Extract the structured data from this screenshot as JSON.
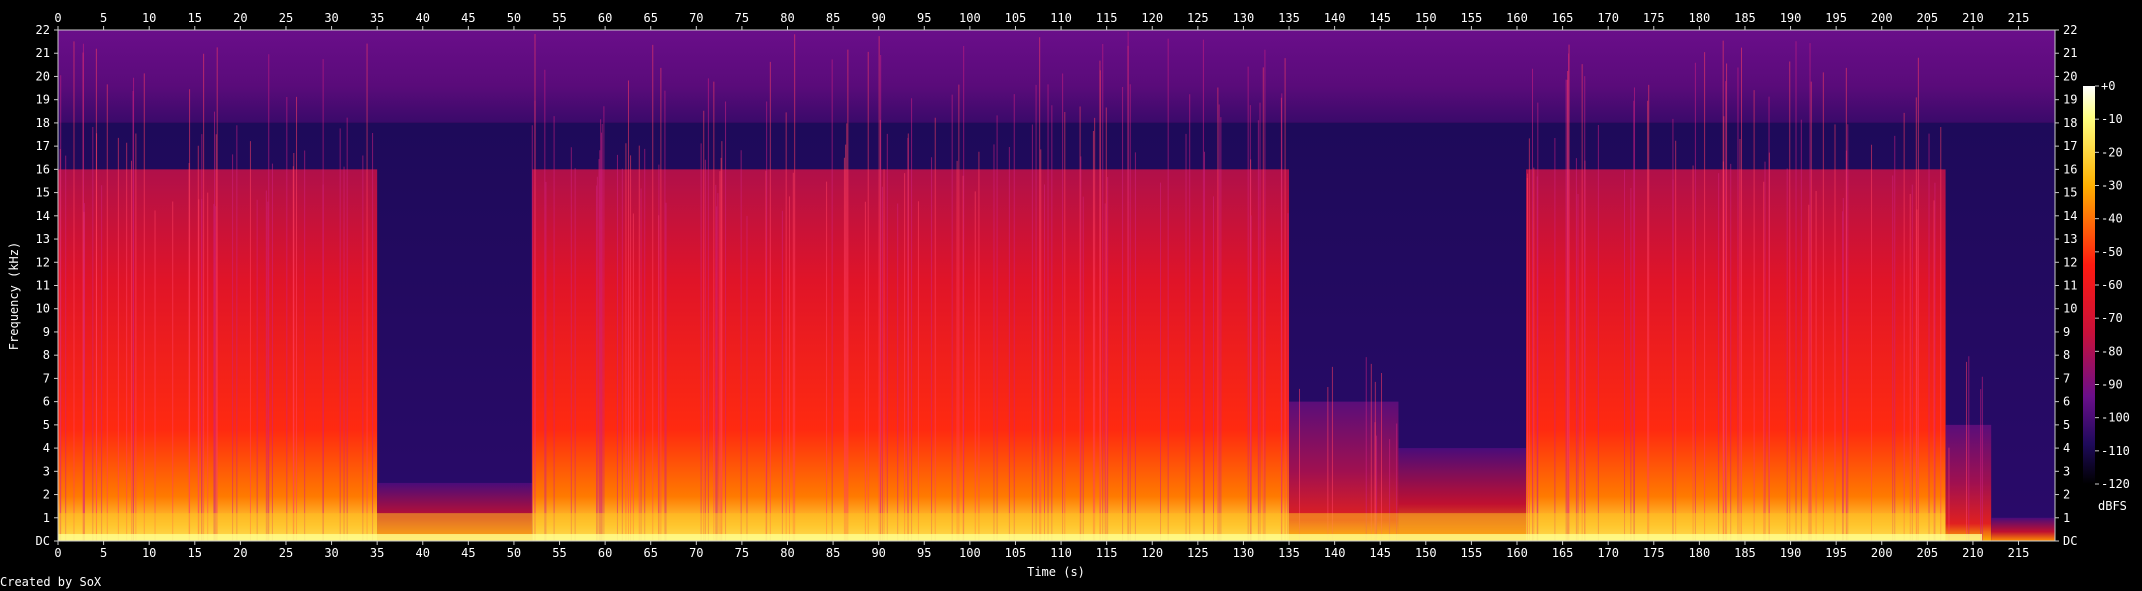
{
  "chart_data": {
    "type": "heatmap",
    "title": "",
    "xlabel": "Time (s)",
    "ylabel": "Frequency (kHz)",
    "xlim": [
      0,
      219
    ],
    "ylim": [
      0,
      22
    ],
    "x_ticks": [
      "0",
      "5",
      "10",
      "15",
      "20",
      "25",
      "30",
      "35",
      "40",
      "45",
      "50",
      "55",
      "60",
      "65",
      "70",
      "75",
      "80",
      "85",
      "90",
      "95",
      "100",
      "105",
      "110",
      "115",
      "120",
      "125",
      "130",
      "135",
      "140",
      "145",
      "150",
      "155",
      "160",
      "165",
      "170",
      "175",
      "180",
      "185",
      "190",
      "195",
      "200",
      "205",
      "210",
      "215"
    ],
    "y_ticks": [
      "DC",
      "1",
      "2",
      "3",
      "4",
      "5",
      "6",
      "7",
      "8",
      "9",
      "10",
      "11",
      "12",
      "13",
      "14",
      "15",
      "16",
      "17",
      "18",
      "19",
      "20",
      "21",
      "22"
    ],
    "colorbar": {
      "label": "dBFS",
      "ticks": [
        "+0",
        "-10",
        "-20",
        "-30",
        "-40",
        "-50",
        "-60",
        "-70",
        "-80",
        "-90",
        "-100",
        "-110",
        "-120"
      ],
      "range": [
        -120,
        0
      ]
    },
    "segments": [
      {
        "t_start": 0,
        "t_end": 35,
        "level": "loud",
        "cutoff_khz": 16
      },
      {
        "t_start": 35,
        "t_end": 52,
        "level": "quiet",
        "cutoff_khz": 2.5
      },
      {
        "t_start": 52,
        "t_end": 135,
        "level": "loud",
        "cutoff_khz": 16
      },
      {
        "t_start": 135,
        "t_end": 147,
        "level": "medium",
        "cutoff_khz": 6
      },
      {
        "t_start": 147,
        "t_end": 161,
        "level": "quiet",
        "cutoff_khz": 4
      },
      {
        "t_start": 161,
        "t_end": 207,
        "level": "loud",
        "cutoff_khz": 16
      },
      {
        "t_start": 207,
        "t_end": 212,
        "level": "medium",
        "cutoff_khz": 5
      },
      {
        "t_start": 212,
        "t_end": 219,
        "level": "quiet",
        "cutoff_khz": 1
      }
    ],
    "noise_floor_cutoff_khz": 18,
    "colors": {
      "background": "#000000",
      "floor_low": "#5a0b7a",
      "floor_high": "#1e0a5a",
      "mid": "#c8103a",
      "loud": "#ff1a10",
      "hot": "#ffb000",
      "peak": "#ffff80"
    }
  },
  "footer": {
    "credit": "Created by SoX"
  }
}
